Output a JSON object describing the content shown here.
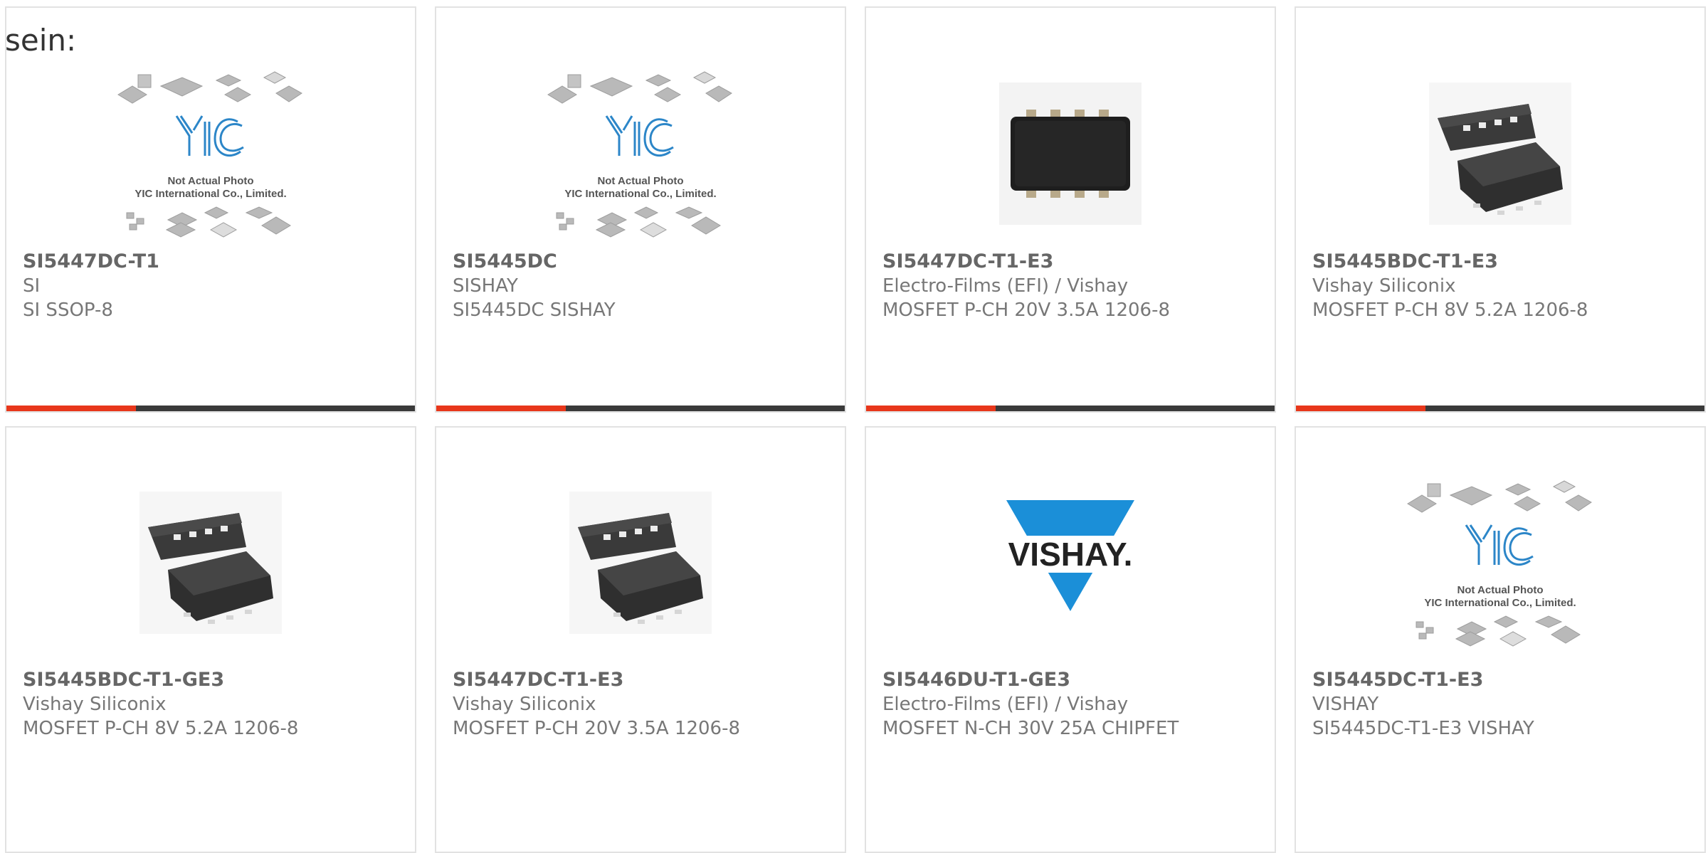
{
  "heading": "sein:",
  "placeholder": {
    "line1": "Not Actual Photo",
    "line2": "YIC International Co., Limited.",
    "logo_text": "YIC"
  },
  "brand_logo_text": "VISHAY.",
  "colors": {
    "accent": "#e8371b",
    "bar": "#3a3a3a",
    "border": "#e2e2e2",
    "vishay_blue": "#1b8fd8",
    "yic_blue": "#2c86c8"
  },
  "products": [
    {
      "part": "SI5447DC-T1",
      "mfr": "SI",
      "desc": "SI SSOP-8",
      "image": "yic-placeholder-icon"
    },
    {
      "part": "SI5445DC",
      "mfr": "SISHAY",
      "desc": "SI5445DC SISHAY",
      "image": "yic-placeholder-icon"
    },
    {
      "part": "SI5447DC-T1-E3",
      "mfr": "Electro-Films (EFI) / Vishay",
      "desc": "MOSFET P-CH 20V 3.5A 1206-8",
      "image": "chip-top-icon"
    },
    {
      "part": "SI5445BDC-T1-E3",
      "mfr": "Vishay Siliconix",
      "desc": "MOSFET P-CH 8V 5.2A 1206-8",
      "image": "chip-3d-icon"
    },
    {
      "part": "SI5445BDC-T1-GE3",
      "mfr": "Vishay Siliconix",
      "desc": "MOSFET P-CH 8V 5.2A 1206-8",
      "image": "chip-3d-icon"
    },
    {
      "part": "SI5447DC-T1-E3",
      "mfr": "Vishay Siliconix",
      "desc": "MOSFET P-CH 20V 3.5A 1206-8",
      "image": "chip-3d-icon"
    },
    {
      "part": "SI5446DU-T1-GE3",
      "mfr": "Electro-Films (EFI) / Vishay",
      "desc": "MOSFET N-CH 30V 25A CHIPFET",
      "image": "vishay-logo"
    },
    {
      "part": "SI5445DC-T1-E3",
      "mfr": "VISHAY",
      "desc": "SI5445DC-T1-E3 VISHAY",
      "image": "yic-placeholder-icon"
    }
  ]
}
